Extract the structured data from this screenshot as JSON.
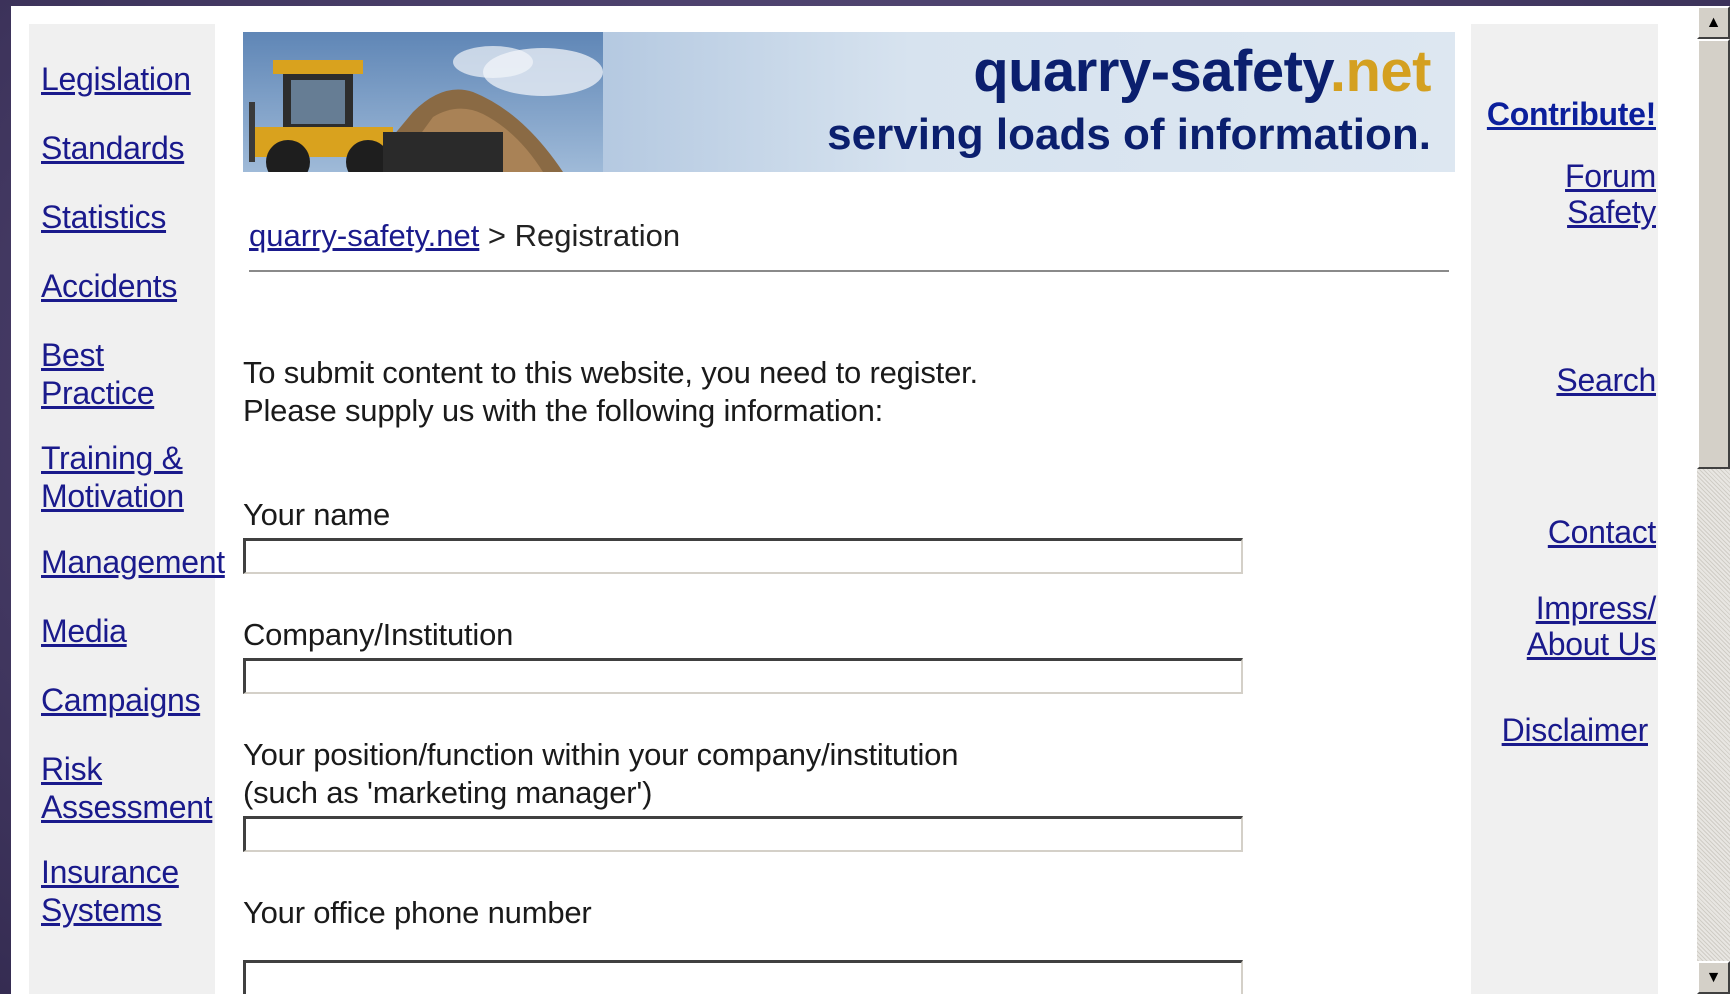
{
  "left_nav": {
    "items": [
      {
        "label": "Legislation"
      },
      {
        "label": "Standards"
      },
      {
        "label": "Statistics"
      },
      {
        "label": "Accidents"
      },
      {
        "label": "Best Practice"
      },
      {
        "label": "Training & Motivation"
      },
      {
        "label": "Management"
      },
      {
        "label": "Media"
      },
      {
        "label": "Campaigns"
      },
      {
        "label": "Risk Assessment"
      },
      {
        "label": "Insurance Systems"
      }
    ]
  },
  "banner": {
    "title_main": "quarry-safety",
    "title_accent": ".net",
    "tagline": "serving loads of information.",
    "accent_color": "#d4a020",
    "title_color": "#0b1f6e"
  },
  "breadcrumb": {
    "home": "quarry-safety.net",
    "separator": " > ",
    "current": "Registration"
  },
  "intro": {
    "line1": "To submit content to this website, you need to register.",
    "line2": "Please supply us with the following information:"
  },
  "form": {
    "name_label": "Your name",
    "name_value": "",
    "company_label": "Company/Institution",
    "company_value": "",
    "position_label_line1": "Your position/function within your company/institution",
    "position_label_line2": "(such as 'marketing manager')",
    "position_value": "",
    "phone_label": "Your office phone number",
    "phone_value": ""
  },
  "right_nav": {
    "contribute": "Contribute!",
    "forum_safety": "Forum Safety",
    "search": "Search",
    "contact": "Contact",
    "impress": "Impress/ About Us",
    "disclaimer": "Disclaimer"
  },
  "scrollbar": {
    "up_icon": "▲",
    "down_icon": "▼"
  },
  "colors": {
    "link": "#1a1a8c",
    "sidebar_bg": "#f0f0f0"
  }
}
